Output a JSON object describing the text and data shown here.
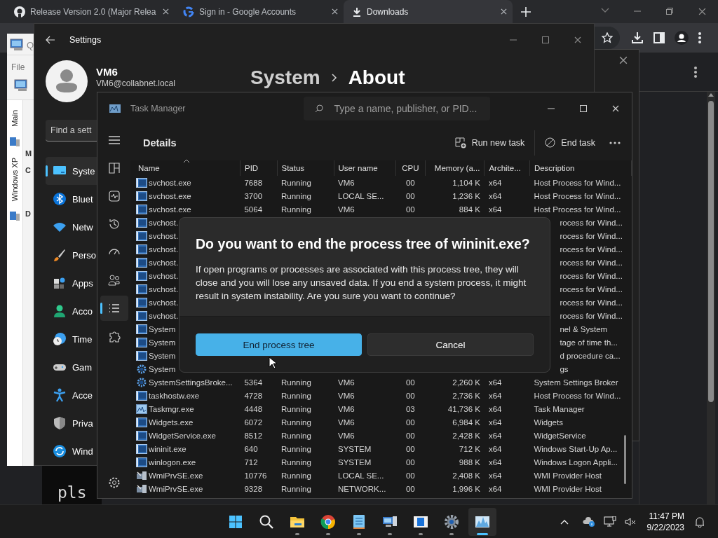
{
  "browser": {
    "tabs": [
      {
        "title": "Release Version 2.0 (Major Relea",
        "selected": false
      },
      {
        "title": "Sign in - Google Accounts",
        "selected": false
      },
      {
        "title": "Downloads",
        "selected": true
      }
    ]
  },
  "vm_window": {
    "search_fragment": "Q",
    "menu": "File",
    "tabs": [
      "Main",
      "Windows XP"
    ],
    "labels": [
      "M",
      "C",
      "D"
    ]
  },
  "terminal": {
    "text": "pls"
  },
  "settings": {
    "title": "Settings",
    "user": {
      "name": "VM6",
      "email": "VM6@collabnet.local"
    },
    "breadcrumb": [
      "System",
      "About"
    ],
    "search": {
      "placeholder": "Find a sett"
    },
    "nav": [
      {
        "label": "Syste",
        "selected": true
      },
      {
        "label": "Bluet",
        "selected": false
      },
      {
        "label": "Netw",
        "selected": false
      },
      {
        "label": "Perso",
        "selected": false
      },
      {
        "label": "Apps",
        "selected": false
      },
      {
        "label": "Acco",
        "selected": false
      },
      {
        "label": "Time",
        "selected": false
      },
      {
        "label": "Gam",
        "selected": false
      },
      {
        "label": "Acce",
        "selected": false
      },
      {
        "label": "Priva",
        "selected": false
      },
      {
        "label": "Wind",
        "selected": false
      }
    ]
  },
  "task_manager": {
    "title": "Task Manager",
    "search": {
      "placeholder": "Type a name, publisher, or PID..."
    },
    "rail": [
      {
        "selected": false
      },
      {
        "selected": false
      },
      {
        "selected": false
      },
      {
        "selected": false
      },
      {
        "selected": false
      },
      {
        "selected": false
      },
      {
        "selected": true
      },
      {
        "selected": false
      },
      {
        "selected": false
      }
    ],
    "page_title": "Details",
    "actions": [
      {
        "label": "Run new task"
      },
      {
        "label": "End task"
      }
    ],
    "columns": [
      {
        "label": "Name",
        "sorted": true
      },
      {
        "label": "PID",
        "sorted": false
      },
      {
        "label": "Status",
        "sorted": false
      },
      {
        "label": "User name",
        "sorted": false
      },
      {
        "label": "CPU",
        "sorted": false
      },
      {
        "label": "Memory (a...",
        "sorted": false
      },
      {
        "label": "Archite...",
        "sorted": false
      },
      {
        "label": "Description",
        "sorted": false
      }
    ],
    "rows": [
      {
        "kind": "window",
        "name": "svchost.exe",
        "pid": "7688",
        "status": "Running",
        "user": "VM6",
        "cpu": "00",
        "memory": "1,104 K",
        "arch": "x64",
        "description": "Host Process for Wind..."
      },
      {
        "kind": "window",
        "name": "svchost.exe",
        "pid": "3700",
        "status": "Running",
        "user": "LOCAL SE...",
        "cpu": "00",
        "memory": "1,236 K",
        "arch": "x64",
        "description": "Host Process for Wind..."
      },
      {
        "kind": "window",
        "name": "svchost.exe",
        "pid": "5064",
        "status": "Running",
        "user": "VM6",
        "cpu": "00",
        "memory": "884 K",
        "arch": "x64",
        "description": "Host Process for Wind..."
      },
      {
        "kind": "window",
        "name": "svchost.",
        "description": "rocess for Wind..."
      },
      {
        "kind": "window",
        "name": "svchost.",
        "description": "rocess for Wind..."
      },
      {
        "kind": "window",
        "name": "svchost.",
        "description": "rocess for Wind..."
      },
      {
        "kind": "window",
        "name": "svchost.",
        "description": "rocess for Wind..."
      },
      {
        "kind": "window",
        "name": "svchost.",
        "description": "rocess for Wind..."
      },
      {
        "kind": "window",
        "name": "svchost.",
        "description": "rocess for Wind..."
      },
      {
        "kind": "window",
        "name": "svchost.",
        "description": "rocess for Wind..."
      },
      {
        "kind": "window",
        "name": "svchost.",
        "description": "rocess for Wind..."
      },
      {
        "kind": "window",
        "name": "System",
        "description": "nel & System"
      },
      {
        "kind": "window",
        "name": "System",
        "description": "tage of time th..."
      },
      {
        "kind": "window",
        "name": "System",
        "description": "d procedure ca..."
      },
      {
        "kind": "gear",
        "name": "System",
        "description": "gs"
      },
      {
        "kind": "gear",
        "name": "SystemSettingsBroke...",
        "pid": "5364",
        "status": "Running",
        "user": "VM6",
        "cpu": "00",
        "memory": "2,260 K",
        "arch": "x64",
        "description": "System Settings Broker"
      },
      {
        "kind": "window",
        "name": "taskhostw.exe",
        "pid": "4728",
        "status": "Running",
        "user": "VM6",
        "cpu": "00",
        "memory": "2,736 K",
        "arch": "x64",
        "description": "Host Process for Wind..."
      },
      {
        "kind": "chart",
        "name": "Taskmgr.exe",
        "pid": "4448",
        "status": "Running",
        "user": "VM6",
        "cpu": "03",
        "memory": "41,736 K",
        "arch": "x64",
        "description": "Task Manager"
      },
      {
        "kind": "window",
        "name": "Widgets.exe",
        "pid": "6072",
        "status": "Running",
        "user": "VM6",
        "cpu": "00",
        "memory": "6,984 K",
        "arch": "x64",
        "description": "Widgets"
      },
      {
        "kind": "window",
        "name": "WidgetService.exe",
        "pid": "8512",
        "status": "Running",
        "user": "VM6",
        "cpu": "00",
        "memory": "2,428 K",
        "arch": "x64",
        "description": "WidgetService"
      },
      {
        "kind": "window",
        "name": "wininit.exe",
        "pid": "640",
        "status": "Running",
        "user": "SYSTEM",
        "cpu": "00",
        "memory": "712 K",
        "arch": "x64",
        "description": "Windows Start-Up Ap..."
      },
      {
        "kind": "window",
        "name": "winlogon.exe",
        "pid": "712",
        "status": "Running",
        "user": "SYSTEM",
        "cpu": "00",
        "memory": "988 K",
        "arch": "x64",
        "description": "Windows Logon Appli..."
      },
      {
        "kind": "computer",
        "name": "WmiPrvSE.exe",
        "pid": "10776",
        "status": "Running",
        "user": "LOCAL SE...",
        "cpu": "00",
        "memory": "2,408 K",
        "arch": "x64",
        "description": "WMI Provider Host"
      },
      {
        "kind": "computer",
        "name": "WmiPrvSE.exe",
        "pid": "9328",
        "status": "Running",
        "user": "NETWORK...",
        "cpu": "00",
        "memory": "1,996 K",
        "arch": "x64",
        "description": "WMI Provider Host"
      }
    ]
  },
  "dialog": {
    "title": "Do you want to end the process tree of wininit.exe?",
    "message": "If open programs or processes are associated with this process tree, they will close and you will lose any unsaved data. If you end a system process, it might result in system instability. Are you sure you want to continue?",
    "buttons": [
      {
        "label": "End process tree",
        "kind": "primary"
      },
      {
        "label": "Cancel",
        "kind": "secondary"
      }
    ]
  },
  "taskbar": {
    "apps": [
      {
        "running": false,
        "selected": false
      },
      {
        "running": false,
        "selected": false
      },
      {
        "running": true,
        "selected": false
      },
      {
        "running": true,
        "selected": false
      },
      {
        "running": true,
        "selected": false
      },
      {
        "running": true,
        "selected": false
      },
      {
        "running": true,
        "selected": false
      },
      {
        "running": true,
        "selected": false
      },
      {
        "running": true,
        "selected": true
      }
    ],
    "time": "11:47 PM",
    "date": "9/22/2023"
  }
}
